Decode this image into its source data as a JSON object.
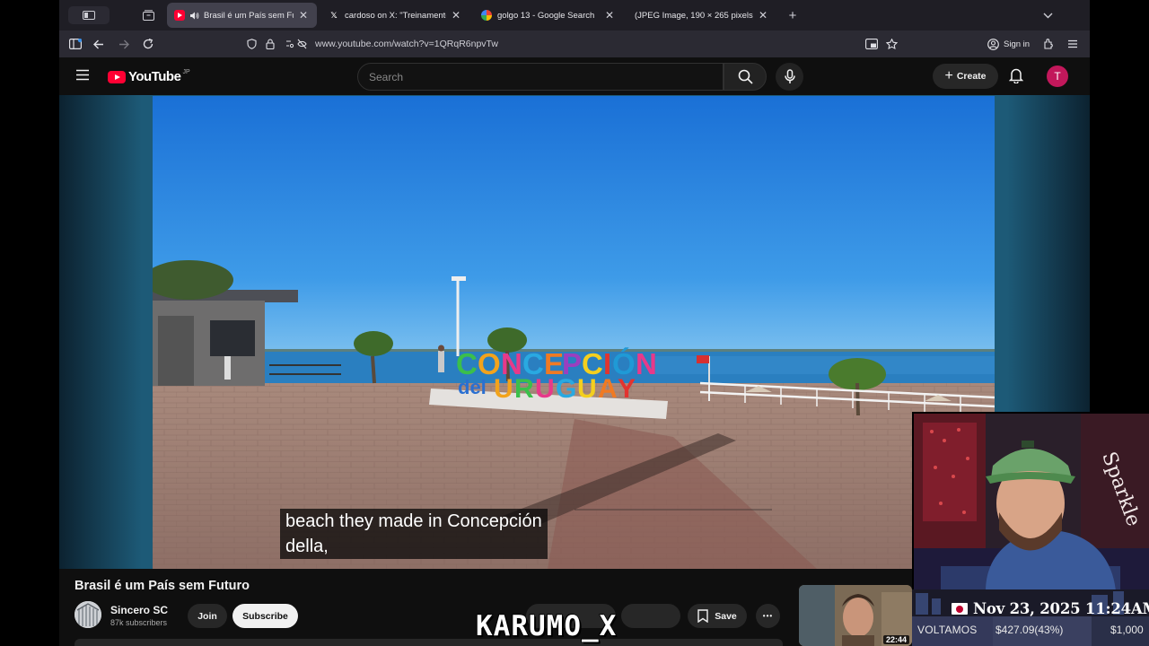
{
  "browser": {
    "tabs": [
      {
        "title": "Brasil é um País sem Futuro",
        "active": true
      },
      {
        "title": "cardoso on X: \"Treinamento no",
        "active": false
      },
      {
        "title": "golgo 13 - Google Search",
        "active": false
      },
      {
        "title": "(JPEG Image, 190 × 265 pixels)",
        "active": false
      }
    ],
    "url": "www.youtube.com/watch?v=1QRqR6npvTw",
    "sign_in": "Sign in"
  },
  "youtube": {
    "logo_text": "YouTube",
    "country_code": "JP",
    "search_placeholder": "Search",
    "create_label": "Create",
    "avatar_letter": "T"
  },
  "video": {
    "sign_letters": "CONCEPCIÓN del URUGUAY",
    "caption_line1": "beach they made in Concepción",
    "caption_line2": "della,",
    "title": "Brasil é um País sem Futuro",
    "channel_name": "Sincero SC",
    "subscribers": "87k subscribers",
    "join_label": "Join",
    "subscribe_label": "Subscribe",
    "save_label": "Save",
    "more_label": "•••",
    "next_thumb_duration": "22:44"
  },
  "overlay": {
    "watermark": "KARUMO_X",
    "date_time": "Nov 23, 2025 11:24AM",
    "ticker_label": "VOLTAMOS",
    "ticker_value": "$427.09(43%)",
    "ticker_goal": "$1,000"
  },
  "colors": {
    "yt_red": "#ff0033",
    "avatar_bg": "#c2185b",
    "sky": "#1e78d8",
    "sea": "#2a7fc0"
  },
  "icons": [
    "sidebar-icon",
    "back-icon",
    "forward-icon",
    "reload-icon",
    "shield-icon",
    "lock-icon",
    "permissions-icon",
    "picture-in-picture-icon",
    "bookmark-star-icon",
    "account-icon",
    "extensions-icon",
    "app-menu-icon",
    "hamburger-menu-icon",
    "search-icon",
    "mic-icon",
    "bell-icon",
    "bookmark-save-icon"
  ]
}
